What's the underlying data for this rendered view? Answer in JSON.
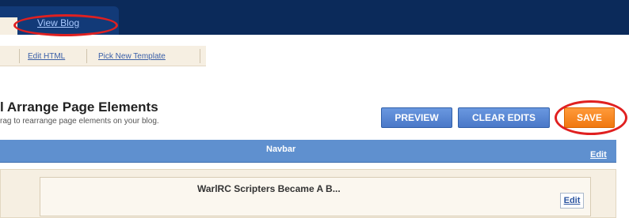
{
  "topnav": {
    "view_blog": "View Blog"
  },
  "subnav": {
    "items": [
      {
        "label": "Edit HTML"
      },
      {
        "label": "Pick New Template"
      }
    ]
  },
  "page": {
    "title": "l Arrange Page Elements",
    "subtitle": "rag to rearrange page elements on your blog."
  },
  "actions": {
    "preview": "PREVIEW",
    "clear_edits": "CLEAR EDITS",
    "save": "SAVE"
  },
  "colors": {
    "topbar": "#0b2a5a",
    "button_blue": "#4a78c8",
    "button_save": "#f07810",
    "highlight_ellipse": "#e02020",
    "widget_bar": "#5f90cf"
  },
  "layout_elements": {
    "navbar": {
      "title": "Navbar",
      "edit": "Edit"
    },
    "header": {
      "title": "WarlRC Scripters Became A B...",
      "edit": "Edit"
    }
  }
}
